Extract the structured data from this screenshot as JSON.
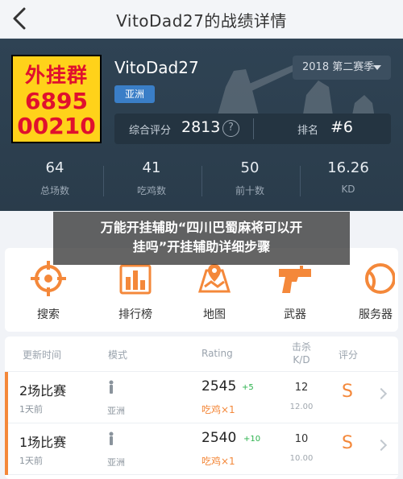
{
  "nav": {
    "title": "VitoDad27的战绩详情",
    "back_icon": "back-arrow-icon"
  },
  "profile": {
    "promo": {
      "line1": "外挂群",
      "line2": "6895",
      "line3": "00210"
    },
    "name": "VitoDad27",
    "region_badge": "亚洲",
    "season": "2018 第二赛季",
    "rating_label": "综合评分",
    "rating_value": "2813",
    "help_icon": "?",
    "rank_label": "排名",
    "rank_value": "#6"
  },
  "stats": [
    {
      "value": "64",
      "label": "总场数"
    },
    {
      "value": "41",
      "label": "吃鸡数"
    },
    {
      "value": "50",
      "label": "前十数"
    },
    {
      "value": "16.26",
      "label": "KD"
    }
  ],
  "caption": {
    "line1": "万能开挂辅助“四川巴蜀麻将可以开",
    "line2": "挂吗”开挂辅助详细步骤"
  },
  "menu": [
    {
      "label": "搜索",
      "icon": "crosshair-icon"
    },
    {
      "label": "排行榜",
      "icon": "leaderboard-icon"
    },
    {
      "label": "地图",
      "icon": "map-icon"
    },
    {
      "label": "武器",
      "icon": "pistol-icon"
    },
    {
      "label": "服务器",
      "icon": "server-icon"
    }
  ],
  "table": {
    "headers": {
      "time": "更新时间",
      "mode": "模式",
      "rating": "Rating",
      "kd_top": "击杀",
      "kd_bottom": "K/D",
      "grade": "评分"
    },
    "rows": [
      {
        "mode": "2场比赛",
        "when": "1天前",
        "region": "亚洲",
        "rating": "2545",
        "delta": "+5",
        "kills": "吃鸡×1",
        "kd": "12",
        "kd_sub": "12.00",
        "grade": "S"
      },
      {
        "mode": "1场比赛",
        "when": "1天前",
        "region": "亚洲",
        "rating": "2540",
        "delta": "+10",
        "kills": "吃鸡×1",
        "kd": "10",
        "kd_sub": "10.00",
        "grade": "S"
      }
    ]
  },
  "colors": {
    "accent": "#f4883a",
    "hero_bg": "#2f4354",
    "badge_blue": "#3a7ec7",
    "delta_green": "#2bb24c",
    "promo_yellow": "#ffd21a",
    "promo_red": "#e0102e"
  }
}
